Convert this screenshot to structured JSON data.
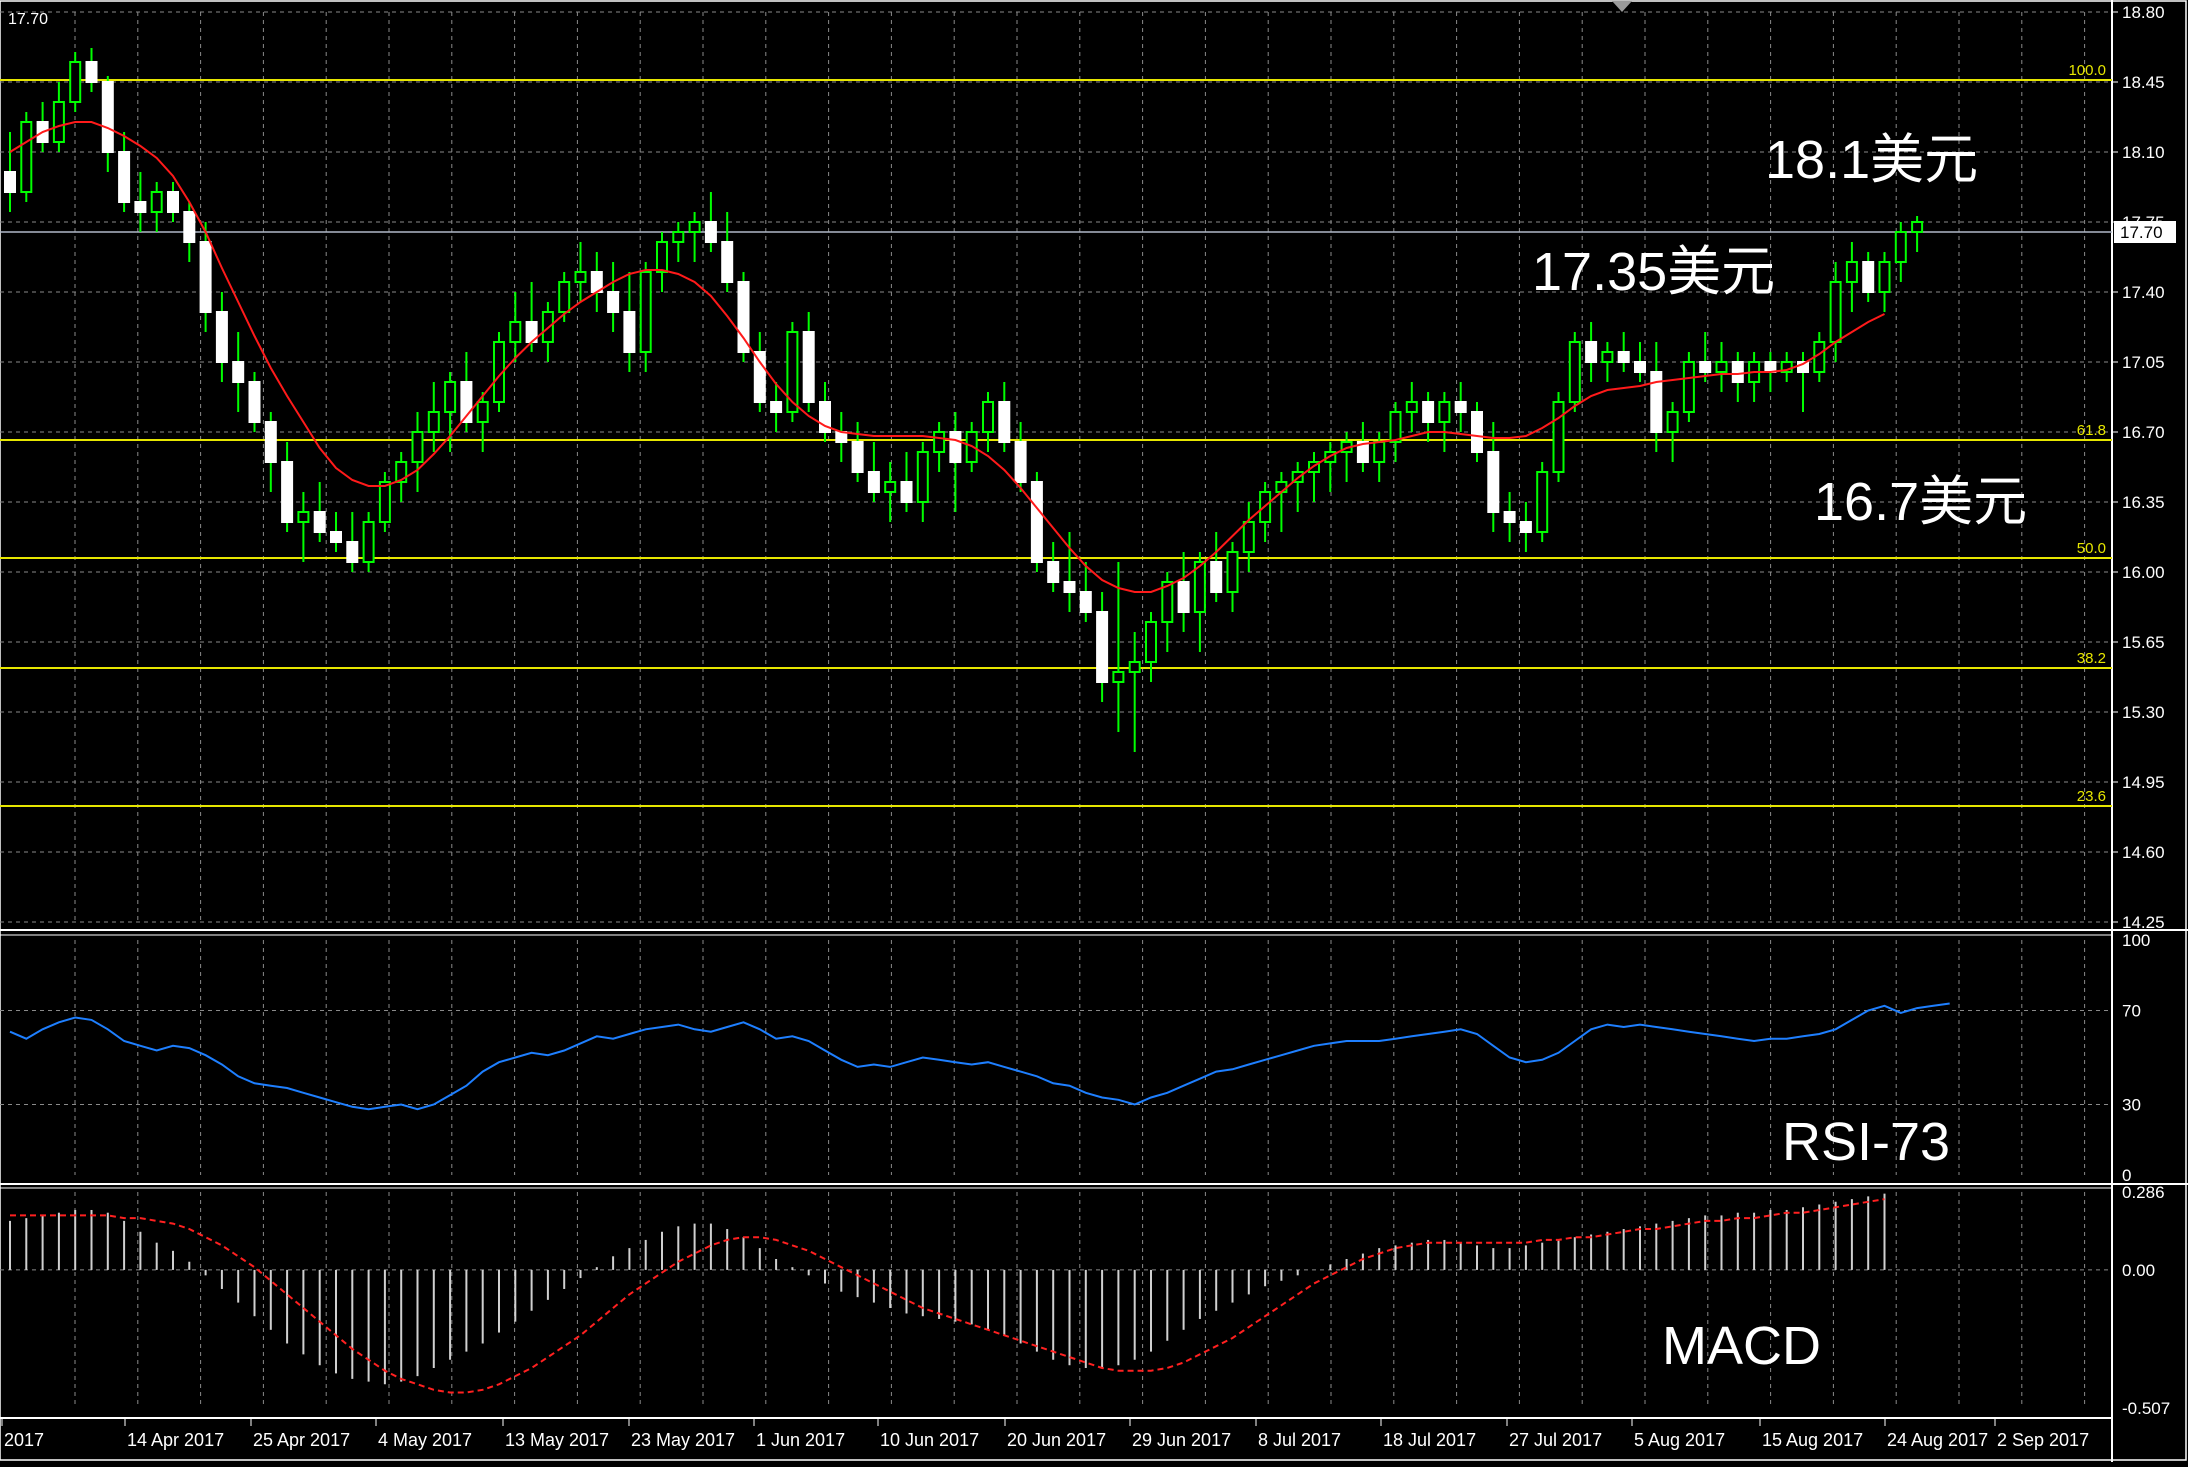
{
  "colors": {
    "background": "#000000",
    "grid": "#8a8a8a",
    "axis": "#ffffff",
    "bull": "#00ff00",
    "bear": "#ffffff",
    "ma": "#ff1a1a",
    "fib": "#e6e600",
    "rsi": "#1e7fff",
    "macd_hist": "#d0d0d0",
    "macd_signal": "#ff2020",
    "annotation": "#ffffff"
  },
  "chart_data": [
    {
      "type": "candlestick",
      "ylim": [
        14.25,
        18.8
      ],
      "y_ticks": [
        "18.80",
        "18.45",
        "18.10",
        "17.75",
        "17.40",
        "17.05",
        "16.70",
        "16.35",
        "16.00",
        "15.65",
        "15.30",
        "14.95",
        "14.60",
        "14.25"
      ],
      "current_price_label": "17.70",
      "current_price": 17.7,
      "top_left_label": "17.70",
      "fib_levels": [
        {
          "label": "100.0",
          "value": 18.46
        },
        {
          "label": "61.8",
          "value": 16.66
        },
        {
          "label": "50.0",
          "value": 16.07
        },
        {
          "label": "38.2",
          "value": 15.52
        },
        {
          "label": "23.6",
          "value": 14.83
        }
      ],
      "annotations": [
        "18.1美元",
        "17.35美元",
        "16.7美元"
      ],
      "ohlc": [
        [
          18.0,
          18.2,
          17.8,
          17.9
        ],
        [
          17.9,
          18.3,
          17.85,
          18.25
        ],
        [
          18.25,
          18.35,
          18.1,
          18.15
        ],
        [
          18.15,
          18.45,
          18.1,
          18.35
        ],
        [
          18.35,
          18.6,
          18.3,
          18.55
        ],
        [
          18.55,
          18.62,
          18.4,
          18.45
        ],
        [
          18.45,
          18.48,
          18.0,
          18.1
        ],
        [
          18.1,
          18.2,
          17.8,
          17.85
        ],
        [
          17.85,
          18.0,
          17.7,
          17.8
        ],
        [
          17.8,
          17.95,
          17.7,
          17.9
        ],
        [
          17.9,
          17.95,
          17.75,
          17.8
        ],
        [
          17.8,
          17.85,
          17.55,
          17.65
        ],
        [
          17.65,
          17.75,
          17.2,
          17.3
        ],
        [
          17.3,
          17.4,
          16.95,
          17.05
        ],
        [
          17.05,
          17.2,
          16.8,
          16.95
        ],
        [
          16.95,
          17.0,
          16.7,
          16.75
        ],
        [
          16.75,
          16.8,
          16.4,
          16.55
        ],
        [
          16.55,
          16.65,
          16.2,
          16.25
        ],
        [
          16.25,
          16.4,
          16.05,
          16.3
        ],
        [
          16.3,
          16.45,
          16.15,
          16.2
        ],
        [
          16.2,
          16.3,
          16.1,
          16.15
        ],
        [
          16.15,
          16.3,
          16.0,
          16.05
        ],
        [
          16.05,
          16.3,
          16.0,
          16.25
        ],
        [
          16.25,
          16.5,
          16.2,
          16.45
        ],
        [
          16.45,
          16.6,
          16.35,
          16.55
        ],
        [
          16.55,
          16.8,
          16.4,
          16.7
        ],
        [
          16.7,
          16.95,
          16.6,
          16.8
        ],
        [
          16.8,
          17.0,
          16.6,
          16.95
        ],
        [
          16.95,
          17.1,
          16.7,
          16.75
        ],
        [
          16.75,
          16.9,
          16.6,
          16.85
        ],
        [
          16.85,
          17.2,
          16.8,
          17.15
        ],
        [
          17.15,
          17.4,
          17.05,
          17.25
        ],
        [
          17.25,
          17.45,
          17.1,
          17.15
        ],
        [
          17.15,
          17.35,
          17.05,
          17.3
        ],
        [
          17.3,
          17.5,
          17.25,
          17.45
        ],
        [
          17.45,
          17.65,
          17.35,
          17.5
        ],
        [
          17.5,
          17.6,
          17.3,
          17.4
        ],
        [
          17.4,
          17.55,
          17.2,
          17.3
        ],
        [
          17.3,
          17.5,
          17.0,
          17.1
        ],
        [
          17.1,
          17.55,
          17.0,
          17.5
        ],
        [
          17.5,
          17.7,
          17.4,
          17.65
        ],
        [
          17.65,
          17.75,
          17.55,
          17.7
        ],
        [
          17.7,
          17.8,
          17.55,
          17.75
        ],
        [
          17.75,
          17.9,
          17.6,
          17.65
        ],
        [
          17.65,
          17.8,
          17.4,
          17.45
        ],
        [
          17.45,
          17.5,
          17.05,
          17.1
        ],
        [
          17.1,
          17.2,
          16.8,
          16.85
        ],
        [
          16.85,
          16.95,
          16.7,
          16.8
        ],
        [
          16.8,
          17.25,
          16.75,
          17.2
        ],
        [
          17.2,
          17.3,
          16.8,
          16.85
        ],
        [
          16.85,
          16.95,
          16.65,
          16.7
        ],
        [
          16.7,
          16.8,
          16.55,
          16.65
        ],
        [
          16.65,
          16.75,
          16.45,
          16.5
        ],
        [
          16.5,
          16.65,
          16.35,
          16.4
        ],
        [
          16.4,
          16.55,
          16.25,
          16.45
        ],
        [
          16.45,
          16.6,
          16.3,
          16.35
        ],
        [
          16.35,
          16.65,
          16.25,
          16.6
        ],
        [
          16.6,
          16.75,
          16.5,
          16.7
        ],
        [
          16.7,
          16.8,
          16.3,
          16.55
        ],
        [
          16.55,
          16.75,
          16.5,
          16.7
        ],
        [
          16.7,
          16.9,
          16.6,
          16.85
        ],
        [
          16.85,
          16.95,
          16.6,
          16.65
        ],
        [
          16.65,
          16.75,
          16.4,
          16.45
        ],
        [
          16.45,
          16.5,
          16.0,
          16.05
        ],
        [
          16.05,
          16.15,
          15.9,
          15.95
        ],
        [
          15.95,
          16.2,
          15.8,
          15.9
        ],
        [
          15.9,
          16.05,
          15.75,
          15.8
        ],
        [
          15.8,
          15.9,
          15.35,
          15.45
        ],
        [
          15.45,
          16.05,
          15.2,
          15.5
        ],
        [
          15.5,
          15.7,
          15.1,
          15.55
        ],
        [
          15.55,
          15.8,
          15.45,
          15.75
        ],
        [
          15.75,
          16.0,
          15.6,
          15.95
        ],
        [
          15.95,
          16.1,
          15.7,
          15.8
        ],
        [
          15.8,
          16.1,
          15.6,
          16.05
        ],
        [
          16.05,
          16.2,
          15.85,
          15.9
        ],
        [
          15.9,
          16.15,
          15.8,
          16.1
        ],
        [
          16.1,
          16.35,
          16.0,
          16.25
        ],
        [
          16.25,
          16.45,
          16.15,
          16.4
        ],
        [
          16.4,
          16.5,
          16.2,
          16.45
        ],
        [
          16.45,
          16.55,
          16.3,
          16.5
        ],
        [
          16.5,
          16.6,
          16.35,
          16.55
        ],
        [
          16.55,
          16.65,
          16.4,
          16.6
        ],
        [
          16.6,
          16.7,
          16.45,
          16.65
        ],
        [
          16.65,
          16.75,
          16.5,
          16.55
        ],
        [
          16.55,
          16.7,
          16.45,
          16.65
        ],
        [
          16.65,
          16.85,
          16.55,
          16.8
        ],
        [
          16.8,
          16.95,
          16.7,
          16.85
        ],
        [
          16.85,
          16.9,
          16.65,
          16.75
        ],
        [
          16.75,
          16.9,
          16.6,
          16.85
        ],
        [
          16.85,
          16.95,
          16.7,
          16.8
        ],
        [
          16.8,
          16.85,
          16.55,
          16.6
        ],
        [
          16.6,
          16.75,
          16.2,
          16.3
        ],
        [
          16.3,
          16.4,
          16.15,
          16.25
        ],
        [
          16.25,
          16.35,
          16.1,
          16.2
        ],
        [
          16.2,
          16.55,
          16.15,
          16.5
        ],
        [
          16.5,
          16.9,
          16.45,
          16.85
        ],
        [
          16.85,
          17.2,
          16.8,
          17.15
        ],
        [
          17.15,
          17.25,
          16.95,
          17.05
        ],
        [
          17.05,
          17.15,
          16.95,
          17.1
        ],
        [
          17.1,
          17.2,
          17.0,
          17.05
        ],
        [
          17.05,
          17.15,
          16.95,
          17.0
        ],
        [
          17.0,
          17.15,
          16.6,
          16.7
        ],
        [
          16.7,
          16.85,
          16.55,
          16.8
        ],
        [
          16.8,
          17.1,
          16.75,
          17.05
        ],
        [
          17.05,
          17.2,
          16.95,
          17.0
        ],
        [
          17.0,
          17.15,
          16.9,
          17.05
        ],
        [
          17.05,
          17.1,
          16.85,
          16.95
        ],
        [
          16.95,
          17.1,
          16.85,
          17.05
        ],
        [
          17.05,
          17.1,
          16.9,
          17.0
        ],
        [
          17.0,
          17.1,
          16.95,
          17.05
        ],
        [
          17.05,
          17.1,
          16.8,
          17.0
        ],
        [
          17.0,
          17.2,
          16.95,
          17.15
        ],
        [
          17.15,
          17.55,
          17.05,
          17.45
        ],
        [
          17.45,
          17.65,
          17.3,
          17.55
        ],
        [
          17.55,
          17.6,
          17.35,
          17.4
        ],
        [
          17.4,
          17.6,
          17.3,
          17.55
        ],
        [
          17.55,
          17.75,
          17.45,
          17.7
        ],
        [
          17.7,
          17.78,
          17.6,
          17.75
        ]
      ],
      "ma": [
        18.1,
        18.15,
        18.2,
        18.23,
        18.25,
        18.25,
        18.22,
        18.18,
        18.13,
        18.07,
        17.98,
        17.85,
        17.7,
        17.52,
        17.35,
        17.18,
        17.02,
        16.88,
        16.75,
        16.62,
        16.52,
        16.46,
        16.43,
        16.43,
        16.46,
        16.51,
        16.59,
        16.68,
        16.78,
        16.88,
        16.98,
        17.07,
        17.15,
        17.22,
        17.29,
        17.35,
        17.4,
        17.45,
        17.49,
        17.51,
        17.51,
        17.49,
        17.45,
        17.38,
        17.28,
        17.17,
        17.05,
        16.94,
        16.85,
        16.78,
        16.73,
        16.7,
        16.69,
        16.68,
        16.68,
        16.68,
        16.68,
        16.67,
        16.66,
        16.63,
        16.58,
        16.51,
        16.42,
        16.32,
        16.22,
        16.12,
        16.03,
        15.96,
        15.92,
        15.9,
        15.9,
        15.93,
        15.97,
        16.03,
        16.1,
        16.18,
        16.26,
        16.33,
        16.4,
        16.47,
        16.53,
        16.58,
        16.62,
        16.64,
        16.65,
        16.66,
        16.68,
        16.7,
        16.7,
        16.69,
        16.68,
        16.67,
        16.67,
        16.68,
        16.72,
        16.77,
        16.83,
        16.88,
        16.91,
        16.92,
        16.93,
        16.95,
        16.96,
        16.97,
        16.98,
        16.99,
        16.99,
        17.0,
        17.0,
        17.01,
        17.04,
        17.09,
        17.15,
        17.2,
        17.25,
        17.29
      ]
    },
    {
      "type": "line",
      "name": "RSI",
      "ylim": [
        0,
        100
      ],
      "y_ticks": [
        "100",
        "70",
        "30",
        "0"
      ],
      "annotation": "RSI-73",
      "values": [
        61,
        58,
        62,
        65,
        67,
        66,
        62,
        57,
        55,
        53,
        55,
        54,
        51,
        47,
        42,
        39,
        38,
        37,
        35,
        33,
        31,
        29,
        28,
        29,
        30,
        28,
        30,
        34,
        38,
        44,
        48,
        50,
        52,
        51,
        53,
        56,
        59,
        58,
        60,
        62,
        63,
        64,
        62,
        61,
        63,
        65,
        62,
        58,
        59,
        57,
        53,
        49,
        46,
        47,
        46,
        48,
        50,
        49,
        48,
        47,
        48,
        46,
        44,
        42,
        39,
        38,
        35,
        33,
        32,
        30,
        33,
        35,
        38,
        41,
        44,
        45,
        47,
        49,
        51,
        53,
        55,
        56,
        57,
        57,
        57,
        58,
        59,
        60,
        61,
        62,
        60,
        55,
        50,
        48,
        49,
        52,
        57,
        62,
        64,
        63,
        64,
        63,
        62,
        61,
        60,
        59,
        58,
        57,
        58,
        58,
        59,
        60,
        62,
        66,
        70,
        72,
        69,
        71,
        72,
        73
      ],
      "categories": [
        "2017",
        "14 Apr 2017",
        "25 Apr 2017",
        "4 May 2017",
        "13 May 2017",
        "23 May 2017",
        "1 Jun 2017",
        "10 Jun 2017",
        "20 Jun 2017",
        "29 Jun 2017",
        "8 Jul 2017",
        "18 Jul 2017",
        "27 Jul 2017",
        "5 Aug 2017",
        "15 Aug 2017",
        "24 Aug 2017",
        "2 Sep 2017"
      ]
    },
    {
      "type": "bar",
      "name": "MACD",
      "ylim": [
        -0.507,
        0.286
      ],
      "y_ticks": [
        "0.286",
        "0.00",
        "-0.507"
      ],
      "annotation": "MACD",
      "hist": [
        0.18,
        0.19,
        0.2,
        0.21,
        0.22,
        0.22,
        0.21,
        0.18,
        0.14,
        0.1,
        0.07,
        0.03,
        -0.02,
        -0.07,
        -0.12,
        -0.17,
        -0.22,
        -0.27,
        -0.31,
        -0.35,
        -0.38,
        -0.4,
        -0.41,
        -0.42,
        -0.41,
        -0.39,
        -0.36,
        -0.33,
        -0.3,
        -0.27,
        -0.23,
        -0.19,
        -0.15,
        -0.11,
        -0.07,
        -0.03,
        0.01,
        0.05,
        0.08,
        0.11,
        0.14,
        0.16,
        0.17,
        0.17,
        0.15,
        0.12,
        0.08,
        0.04,
        0.01,
        -0.02,
        -0.05,
        -0.08,
        -0.1,
        -0.12,
        -0.14,
        -0.16,
        -0.17,
        -0.18,
        -0.19,
        -0.2,
        -0.22,
        -0.24,
        -0.27,
        -0.3,
        -0.33,
        -0.35,
        -0.36,
        -0.36,
        -0.35,
        -0.33,
        -0.3,
        -0.26,
        -0.22,
        -0.18,
        -0.15,
        -0.12,
        -0.09,
        -0.06,
        -0.04,
        -0.02,
        0.0,
        0.02,
        0.04,
        0.06,
        0.08,
        0.09,
        0.1,
        0.11,
        0.11,
        0.1,
        0.09,
        0.08,
        0.08,
        0.09,
        0.1,
        0.11,
        0.12,
        0.13,
        0.14,
        0.15,
        0.16,
        0.17,
        0.18,
        0.19,
        0.2,
        0.2,
        0.21,
        0.21,
        0.22,
        0.22,
        0.23,
        0.24,
        0.25,
        0.26,
        0.27,
        0.28
      ],
      "signal": [
        0.2,
        0.2,
        0.2,
        0.2,
        0.2,
        0.2,
        0.2,
        0.19,
        0.19,
        0.18,
        0.17,
        0.15,
        0.12,
        0.09,
        0.05,
        0.01,
        -0.04,
        -0.09,
        -0.14,
        -0.19,
        -0.24,
        -0.29,
        -0.33,
        -0.37,
        -0.4,
        -0.42,
        -0.44,
        -0.45,
        -0.45,
        -0.44,
        -0.42,
        -0.39,
        -0.36,
        -0.32,
        -0.28,
        -0.24,
        -0.19,
        -0.14,
        -0.09,
        -0.05,
        -0.01,
        0.03,
        0.06,
        0.09,
        0.11,
        0.12,
        0.12,
        0.11,
        0.09,
        0.07,
        0.04,
        0.01,
        -0.02,
        -0.05,
        -0.08,
        -0.11,
        -0.14,
        -0.16,
        -0.18,
        -0.2,
        -0.22,
        -0.24,
        -0.26,
        -0.28,
        -0.3,
        -0.32,
        -0.34,
        -0.36,
        -0.37,
        -0.37,
        -0.37,
        -0.36,
        -0.34,
        -0.31,
        -0.28,
        -0.25,
        -0.21,
        -0.17,
        -0.13,
        -0.09,
        -0.05,
        -0.02,
        0.01,
        0.04,
        0.06,
        0.08,
        0.09,
        0.1,
        0.1,
        0.1,
        0.1,
        0.1,
        0.1,
        0.1,
        0.11,
        0.11,
        0.12,
        0.12,
        0.13,
        0.14,
        0.15,
        0.15,
        0.16,
        0.17,
        0.18,
        0.18,
        0.19,
        0.19,
        0.2,
        0.21,
        0.21,
        0.22,
        0.23,
        0.24,
        0.25,
        0.26
      ]
    }
  ]
}
